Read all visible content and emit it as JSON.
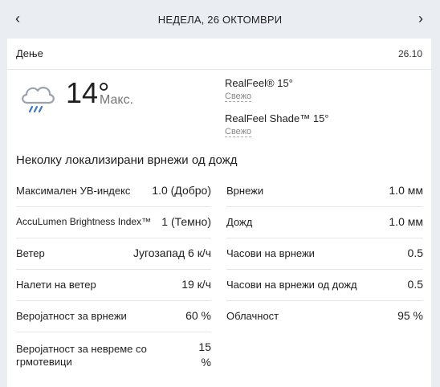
{
  "header": {
    "prev_icon": "chevron-left-icon",
    "next_icon": "chevron-right-icon",
    "date_label": "НЕДЕЛА, 26 ОКТОМВРИ"
  },
  "card": {
    "title": "Дење",
    "date": "26.10",
    "weather_icon": "cloud-rain-icon",
    "temperature": "14°",
    "temp_label": "Макс.",
    "realfeel": {
      "label": "RealFeel® 15°",
      "desc": "Свежо"
    },
    "realfeel_shade": {
      "label": "RealFeel Shade™ 15°",
      "desc": "Свежо"
    },
    "phrase": "Неколку локализирани врнежи од дожд",
    "left_details": [
      {
        "key": "Максимален УВ-индекс",
        "value": "1.0 (Добро)"
      },
      {
        "key": "AccuLumen Brightness Index™",
        "value": "1 (Темно)"
      },
      {
        "key": "Ветер",
        "value": "Југозапад 6 к/ч"
      },
      {
        "key": "Налети на ветер",
        "value": "19 к/ч"
      },
      {
        "key": "Веројатност за врнежи",
        "value": "60 %"
      },
      {
        "key": "Веројатност за невреме со грмотевици",
        "value": "15 %"
      }
    ],
    "right_details": [
      {
        "key": "Врнежи",
        "value": "1.0 мм"
      },
      {
        "key": "Дожд",
        "value": "1.0 мм"
      },
      {
        "key": "Часови на врнежи",
        "value": "0.5"
      },
      {
        "key": "Часови на врнежи од дожд",
        "value": "0.5"
      },
      {
        "key": "Облачност",
        "value": "95 %"
      }
    ]
  }
}
